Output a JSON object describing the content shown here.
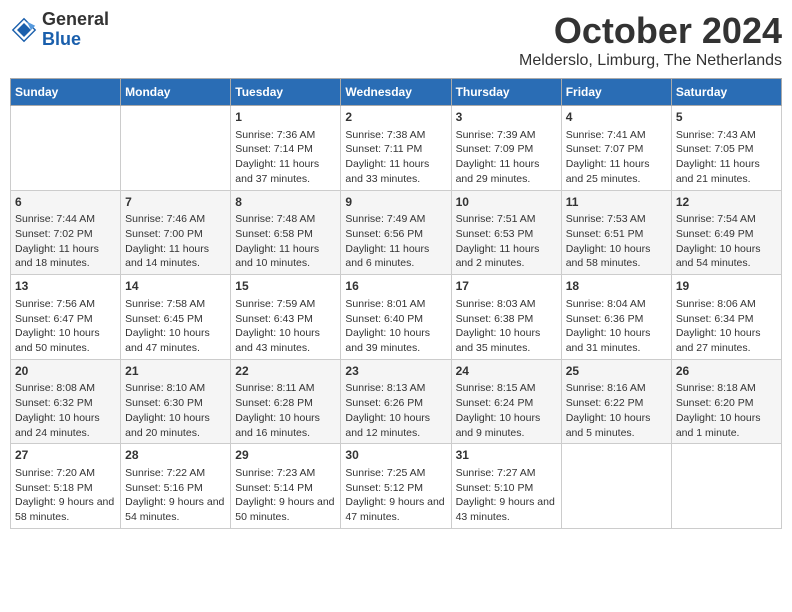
{
  "header": {
    "logo_line1": "General",
    "logo_line2": "Blue",
    "month_title": "October 2024",
    "location": "Melderslo, Limburg, The Netherlands"
  },
  "days_of_week": [
    "Sunday",
    "Monday",
    "Tuesday",
    "Wednesday",
    "Thursday",
    "Friday",
    "Saturday"
  ],
  "weeks": [
    [
      {
        "day": "",
        "info": ""
      },
      {
        "day": "",
        "info": ""
      },
      {
        "day": "1",
        "info": "Sunrise: 7:36 AM\nSunset: 7:14 PM\nDaylight: 11 hours and 37 minutes."
      },
      {
        "day": "2",
        "info": "Sunrise: 7:38 AM\nSunset: 7:11 PM\nDaylight: 11 hours and 33 minutes."
      },
      {
        "day": "3",
        "info": "Sunrise: 7:39 AM\nSunset: 7:09 PM\nDaylight: 11 hours and 29 minutes."
      },
      {
        "day": "4",
        "info": "Sunrise: 7:41 AM\nSunset: 7:07 PM\nDaylight: 11 hours and 25 minutes."
      },
      {
        "day": "5",
        "info": "Sunrise: 7:43 AM\nSunset: 7:05 PM\nDaylight: 11 hours and 21 minutes."
      }
    ],
    [
      {
        "day": "6",
        "info": "Sunrise: 7:44 AM\nSunset: 7:02 PM\nDaylight: 11 hours and 18 minutes."
      },
      {
        "day": "7",
        "info": "Sunrise: 7:46 AM\nSunset: 7:00 PM\nDaylight: 11 hours and 14 minutes."
      },
      {
        "day": "8",
        "info": "Sunrise: 7:48 AM\nSunset: 6:58 PM\nDaylight: 11 hours and 10 minutes."
      },
      {
        "day": "9",
        "info": "Sunrise: 7:49 AM\nSunset: 6:56 PM\nDaylight: 11 hours and 6 minutes."
      },
      {
        "day": "10",
        "info": "Sunrise: 7:51 AM\nSunset: 6:53 PM\nDaylight: 11 hours and 2 minutes."
      },
      {
        "day": "11",
        "info": "Sunrise: 7:53 AM\nSunset: 6:51 PM\nDaylight: 10 hours and 58 minutes."
      },
      {
        "day": "12",
        "info": "Sunrise: 7:54 AM\nSunset: 6:49 PM\nDaylight: 10 hours and 54 minutes."
      }
    ],
    [
      {
        "day": "13",
        "info": "Sunrise: 7:56 AM\nSunset: 6:47 PM\nDaylight: 10 hours and 50 minutes."
      },
      {
        "day": "14",
        "info": "Sunrise: 7:58 AM\nSunset: 6:45 PM\nDaylight: 10 hours and 47 minutes."
      },
      {
        "day": "15",
        "info": "Sunrise: 7:59 AM\nSunset: 6:43 PM\nDaylight: 10 hours and 43 minutes."
      },
      {
        "day": "16",
        "info": "Sunrise: 8:01 AM\nSunset: 6:40 PM\nDaylight: 10 hours and 39 minutes."
      },
      {
        "day": "17",
        "info": "Sunrise: 8:03 AM\nSunset: 6:38 PM\nDaylight: 10 hours and 35 minutes."
      },
      {
        "day": "18",
        "info": "Sunrise: 8:04 AM\nSunset: 6:36 PM\nDaylight: 10 hours and 31 minutes."
      },
      {
        "day": "19",
        "info": "Sunrise: 8:06 AM\nSunset: 6:34 PM\nDaylight: 10 hours and 27 minutes."
      }
    ],
    [
      {
        "day": "20",
        "info": "Sunrise: 8:08 AM\nSunset: 6:32 PM\nDaylight: 10 hours and 24 minutes."
      },
      {
        "day": "21",
        "info": "Sunrise: 8:10 AM\nSunset: 6:30 PM\nDaylight: 10 hours and 20 minutes."
      },
      {
        "day": "22",
        "info": "Sunrise: 8:11 AM\nSunset: 6:28 PM\nDaylight: 10 hours and 16 minutes."
      },
      {
        "day": "23",
        "info": "Sunrise: 8:13 AM\nSunset: 6:26 PM\nDaylight: 10 hours and 12 minutes."
      },
      {
        "day": "24",
        "info": "Sunrise: 8:15 AM\nSunset: 6:24 PM\nDaylight: 10 hours and 9 minutes."
      },
      {
        "day": "25",
        "info": "Sunrise: 8:16 AM\nSunset: 6:22 PM\nDaylight: 10 hours and 5 minutes."
      },
      {
        "day": "26",
        "info": "Sunrise: 8:18 AM\nSunset: 6:20 PM\nDaylight: 10 hours and 1 minute."
      }
    ],
    [
      {
        "day": "27",
        "info": "Sunrise: 7:20 AM\nSunset: 5:18 PM\nDaylight: 9 hours and 58 minutes."
      },
      {
        "day": "28",
        "info": "Sunrise: 7:22 AM\nSunset: 5:16 PM\nDaylight: 9 hours and 54 minutes."
      },
      {
        "day": "29",
        "info": "Sunrise: 7:23 AM\nSunset: 5:14 PM\nDaylight: 9 hours and 50 minutes."
      },
      {
        "day": "30",
        "info": "Sunrise: 7:25 AM\nSunset: 5:12 PM\nDaylight: 9 hours and 47 minutes."
      },
      {
        "day": "31",
        "info": "Sunrise: 7:27 AM\nSunset: 5:10 PM\nDaylight: 9 hours and 43 minutes."
      },
      {
        "day": "",
        "info": ""
      },
      {
        "day": "",
        "info": ""
      }
    ]
  ]
}
